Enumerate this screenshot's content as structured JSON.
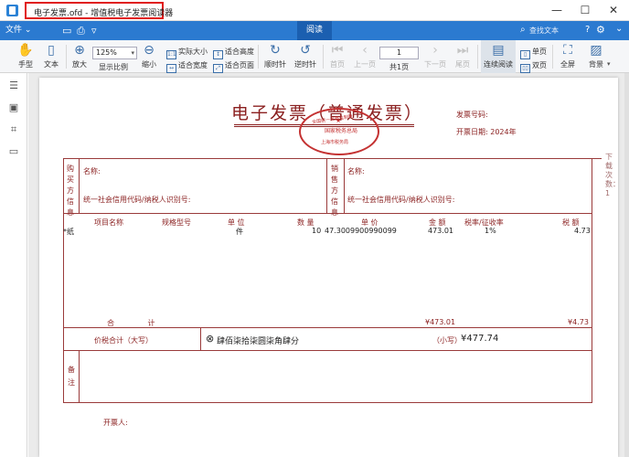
{
  "window": {
    "title": "电子发票.ofd - 增值税电子发票阅读器",
    "minimize": "—",
    "maximize": "☐",
    "close": "✕"
  },
  "ribbon": {
    "file_menu": "文件 ⌄",
    "active_tab": "阅读",
    "search_placeholder": "查找文本",
    "help": "?",
    "settings": "⚙",
    "collapse": "⌄"
  },
  "toolbar": {
    "hand": "手型",
    "text": "文本",
    "zoom_in": "放大",
    "zoom_value": "125%",
    "zoom_label": "显示比例",
    "zoom_out": "缩小",
    "actual_size": "实际大小",
    "fit_height": "适合高度",
    "fit_width": "适合宽度",
    "fit_page": "适合页面",
    "rotate_cw": "顺时针",
    "rotate_ccw": "逆时针",
    "first_page": "首页",
    "prev_page": "上一页",
    "page_number": "1",
    "page_total": "共1页",
    "next_page": "下一页",
    "last_page": "尾页",
    "continuous": "连续阅读",
    "single_page": "单页",
    "double_page": "双页",
    "fullscreen": "全屏",
    "background": "背景"
  },
  "invoice": {
    "title": "电子发票（普通发票）",
    "seal_top": "全国统一发票监制章",
    "seal_mid": "国家税务总局",
    "seal_bot": "上海市税务局",
    "invoice_no_label": "发票号码:",
    "issue_date_label": "开票日期: 2024年",
    "buyer_label": "购买方信息",
    "buyer_name_label": "名称:",
    "buyer_tax_id_label": "统一社会信用代码/纳税人识别号:",
    "seller_label": "销售方信息",
    "seller_name_label": "名称:",
    "seller_tax_id_label": "统一社会信用代码/纳税人识别号:",
    "side_code": "下载次数：1",
    "headers": {
      "item": "项目名称",
      "spec": "规格型号",
      "unit": "单 位",
      "qty": "数 量",
      "price": "单 价",
      "amount": "金 额",
      "rate": "税率/征收率",
      "tax": "税 额"
    },
    "line_item": {
      "item": "*纸",
      "unit": "件",
      "qty": "10",
      "price": "47.3009900990099",
      "amount": "473.01",
      "rate": "1%",
      "tax": "4.73"
    },
    "total_label": "合  计",
    "total_amount": "¥473.01",
    "total_tax": "¥4.73",
    "grand_total_label": "价税合计（大写）",
    "grand_total_words": "肆佰柒拾柒圆柒角肆分",
    "grand_total_small_label": "（小写）",
    "grand_total_value": "¥477.74",
    "remarks_label": "备注",
    "issuer_label": "开票人:"
  }
}
